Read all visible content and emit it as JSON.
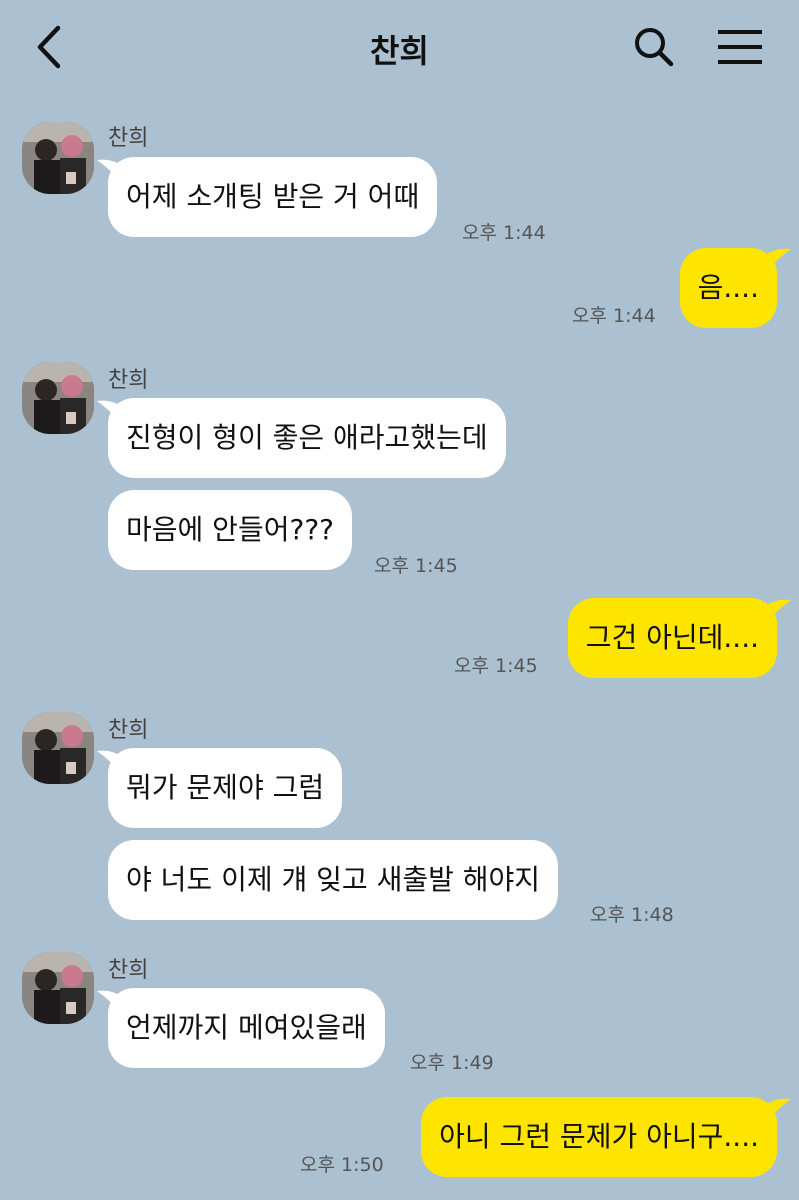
{
  "header": {
    "title": "찬희",
    "back_icon": "chevron-left-icon",
    "search_icon": "search-icon",
    "menu_icon": "hamburger-menu-icon"
  },
  "colors": {
    "background": "#abc1d1",
    "incoming": "#ffffff",
    "outgoing": "#fee500"
  },
  "messages": [
    {
      "sender": "찬희",
      "text": "어제 소개팅 받은 거 어때",
      "time": "오후 1:44"
    },
    {
      "text": "음....",
      "time": "오후 1:44"
    },
    {
      "sender": "찬희",
      "text": "진형이 형이 좋은 애라고했는데"
    },
    {
      "text": "마음에 안들어???",
      "time": "오후 1:45"
    },
    {
      "text": "그건 아닌데....",
      "time": "오후 1:45"
    },
    {
      "sender": "찬희",
      "text": "뭐가 문제야 그럼"
    },
    {
      "text": "야 너도 이제 걔 잊고 새출발 해야지",
      "time": "오후 1:48"
    },
    {
      "sender": "찬희",
      "text": "언제까지 메여있을래",
      "time": "오후 1:49"
    },
    {
      "text": "아니 그런 문제가 아니구....",
      "time": "오후 1:50"
    }
  ]
}
